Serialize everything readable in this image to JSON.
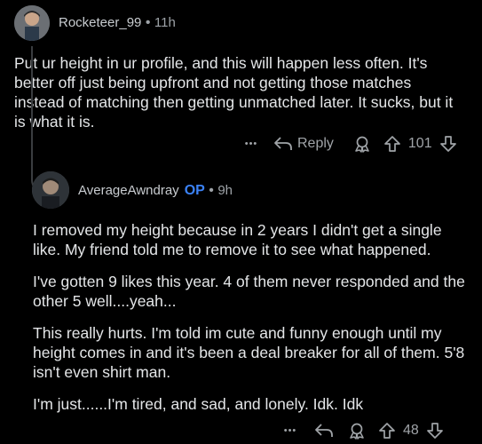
{
  "comment1": {
    "username": "Rocketeer_99",
    "separator": "•",
    "time": "11h",
    "body": "Put ur height in ur profile, and this will happen less often. It's better off just being upfront and not getting those matches instead of matching then getting unmatched later. It sucks, but it is what it is.",
    "more_label": "•••",
    "reply_label": "Reply",
    "score": "101",
    "icons": [
      "more-icon",
      "reply-icon",
      "award-icon",
      "upvote-icon",
      "downvote-icon"
    ]
  },
  "comment2": {
    "username": "AverageAwndray",
    "op_badge": "OP",
    "separator": "•",
    "time": "9h",
    "paragraphs": [
      "I removed my height because in 2 years I didn't get a single like. My friend told me to remove it to see what happened.",
      "I've gotten 9 likes this year. 4 of them never responded and the other 5 well....yeah...",
      "This really hurts. I'm told im cute and funny enough until my height comes in and it's been a deal breaker for all of them. 5'8 isn't even shirt man.",
      "I'm just......I'm tired, and sad, and lonely. Idk. Idk"
    ],
    "more_label": "•••",
    "score": "48",
    "icons": [
      "more-icon",
      "reply-icon",
      "award-icon",
      "upvote-icon",
      "downvote-icon"
    ]
  },
  "colors": {
    "background": "#000000",
    "text": "#e4e6e8",
    "muted": "#9ea3a8",
    "op": "#3b82f6"
  }
}
